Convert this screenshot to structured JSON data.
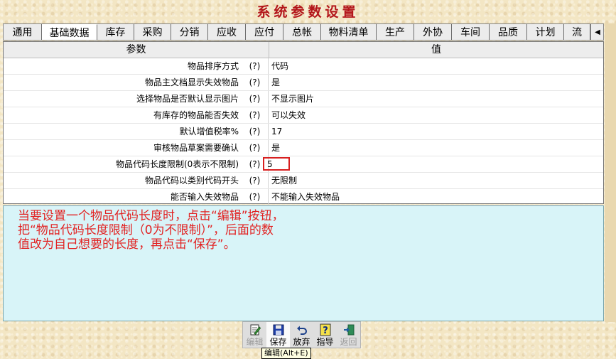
{
  "window": {
    "title": "系统参数设置"
  },
  "tabs": [
    {
      "label": "通用"
    },
    {
      "label": "基础数据",
      "active": true
    },
    {
      "label": "库存"
    },
    {
      "label": "采购"
    },
    {
      "label": "分销"
    },
    {
      "label": "应收"
    },
    {
      "label": "应付"
    },
    {
      "label": "总帐"
    },
    {
      "label": "物料清单"
    },
    {
      "label": "生产"
    },
    {
      "label": "外协"
    },
    {
      "label": "车间"
    },
    {
      "label": "品质"
    },
    {
      "label": "计划"
    },
    {
      "label": "流"
    }
  ],
  "tab_scroll": {
    "left": "◀",
    "right": "▶"
  },
  "grid": {
    "header_param": "参数",
    "header_value": "值",
    "help_symbol": "(?)",
    "rows": [
      {
        "param": "物品排序方式",
        "value": "代码"
      },
      {
        "param": "物品主文档显示失效物品",
        "value": "是"
      },
      {
        "param": "选择物品是否默认显示图片",
        "value": "不显示图片"
      },
      {
        "param": "有库存的物品能否失效",
        "value": "可以失效"
      },
      {
        "param": "默认增值税率%",
        "value": "17"
      },
      {
        "param": "审核物品草案需要确认",
        "value": "是"
      },
      {
        "param": "物品代码长度限制(0表示不限制)",
        "value": "5",
        "highlighted": true
      },
      {
        "param": "物品代码以类别代码开头",
        "value": "无限制"
      },
      {
        "param": "能否输入失效物品",
        "value": "不能输入失效物品"
      }
    ]
  },
  "note": {
    "text": "当要设置一个物品代码长度时，点击“编辑”按钮，\n把“物品代码长度限制（0为不限制）”，后面的数\n值改为自己想要的长度，再点击“保存”。"
  },
  "toolbar": {
    "edit": "编辑",
    "save": "保存",
    "discard": "放弃",
    "guide": "指导",
    "back": "返回"
  },
  "tooltip": "编辑(Alt+E)",
  "colors": {
    "title": "#b3161a",
    "note_text": "#e22222",
    "note_bg": "#d8f4f8",
    "highlight_border": "#d81f1f"
  }
}
